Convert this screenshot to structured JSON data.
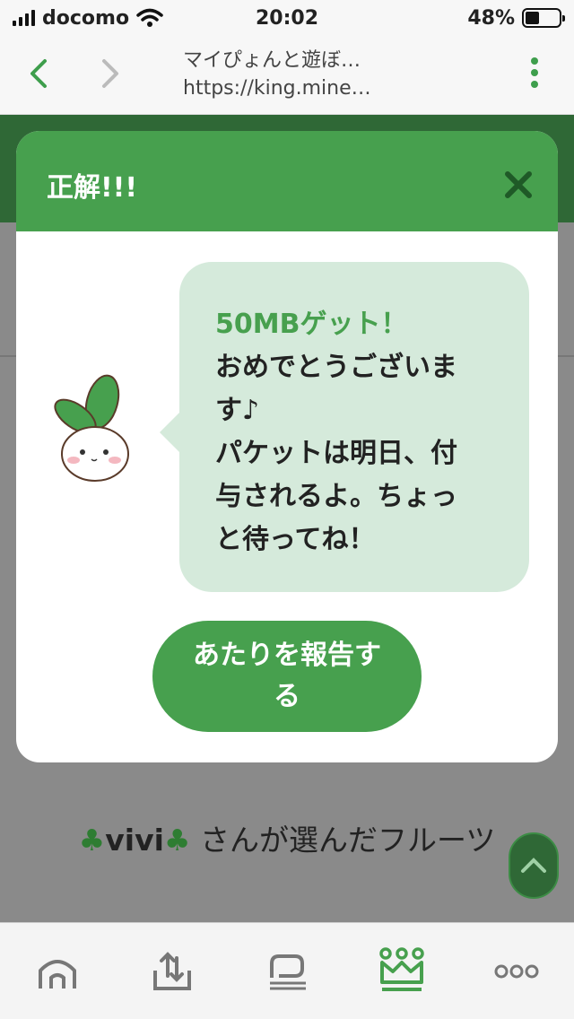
{
  "status_bar": {
    "carrier": "docomo",
    "time": "20:02",
    "battery": "48%",
    "battery_level": 0.48
  },
  "browser": {
    "page_title": "マイぴょんと遊ぼ…",
    "url": "https://king.mine…"
  },
  "page": {
    "chosen_user": "vivi",
    "chosen_suffix": "さんが選んだフルーツ"
  },
  "modal": {
    "title": "正解!!!",
    "headline": "50MBゲット！",
    "message_line1": "おめでとうございま",
    "message_line2": "す♪",
    "message_line3": "パケットは明日、付",
    "message_line4": "与されるよ。ちょっ",
    "message_line5": "と待ってね！",
    "report_button_line1": "あたりを報告す",
    "report_button_line2": "る"
  },
  "colors": {
    "accent": "#47a04e",
    "bubble": "#d5eadb",
    "header_dark": "#2f6836"
  },
  "icons": [
    "back-icon",
    "forward-icon",
    "more-icon",
    "close-icon",
    "clover-icon",
    "chevron-up-icon",
    "home-icon",
    "upload-icon",
    "chat-icon",
    "crown-icon",
    "more-horizontal-icon"
  ]
}
